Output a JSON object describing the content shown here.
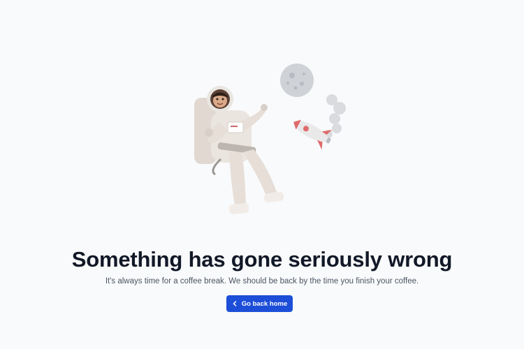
{
  "error_page": {
    "title": "Something has gone seriously wrong",
    "message": "It's always time for a coffee break. We should be back by the time you finish your coffee.",
    "home_button_label": "Go back home",
    "home_button_icon": "chevron-left-icon"
  },
  "colors": {
    "background": "#f9fafb",
    "title": "#111827",
    "message": "#4b5563",
    "button": "#1d4ed8",
    "button_text": "#ffffff"
  }
}
